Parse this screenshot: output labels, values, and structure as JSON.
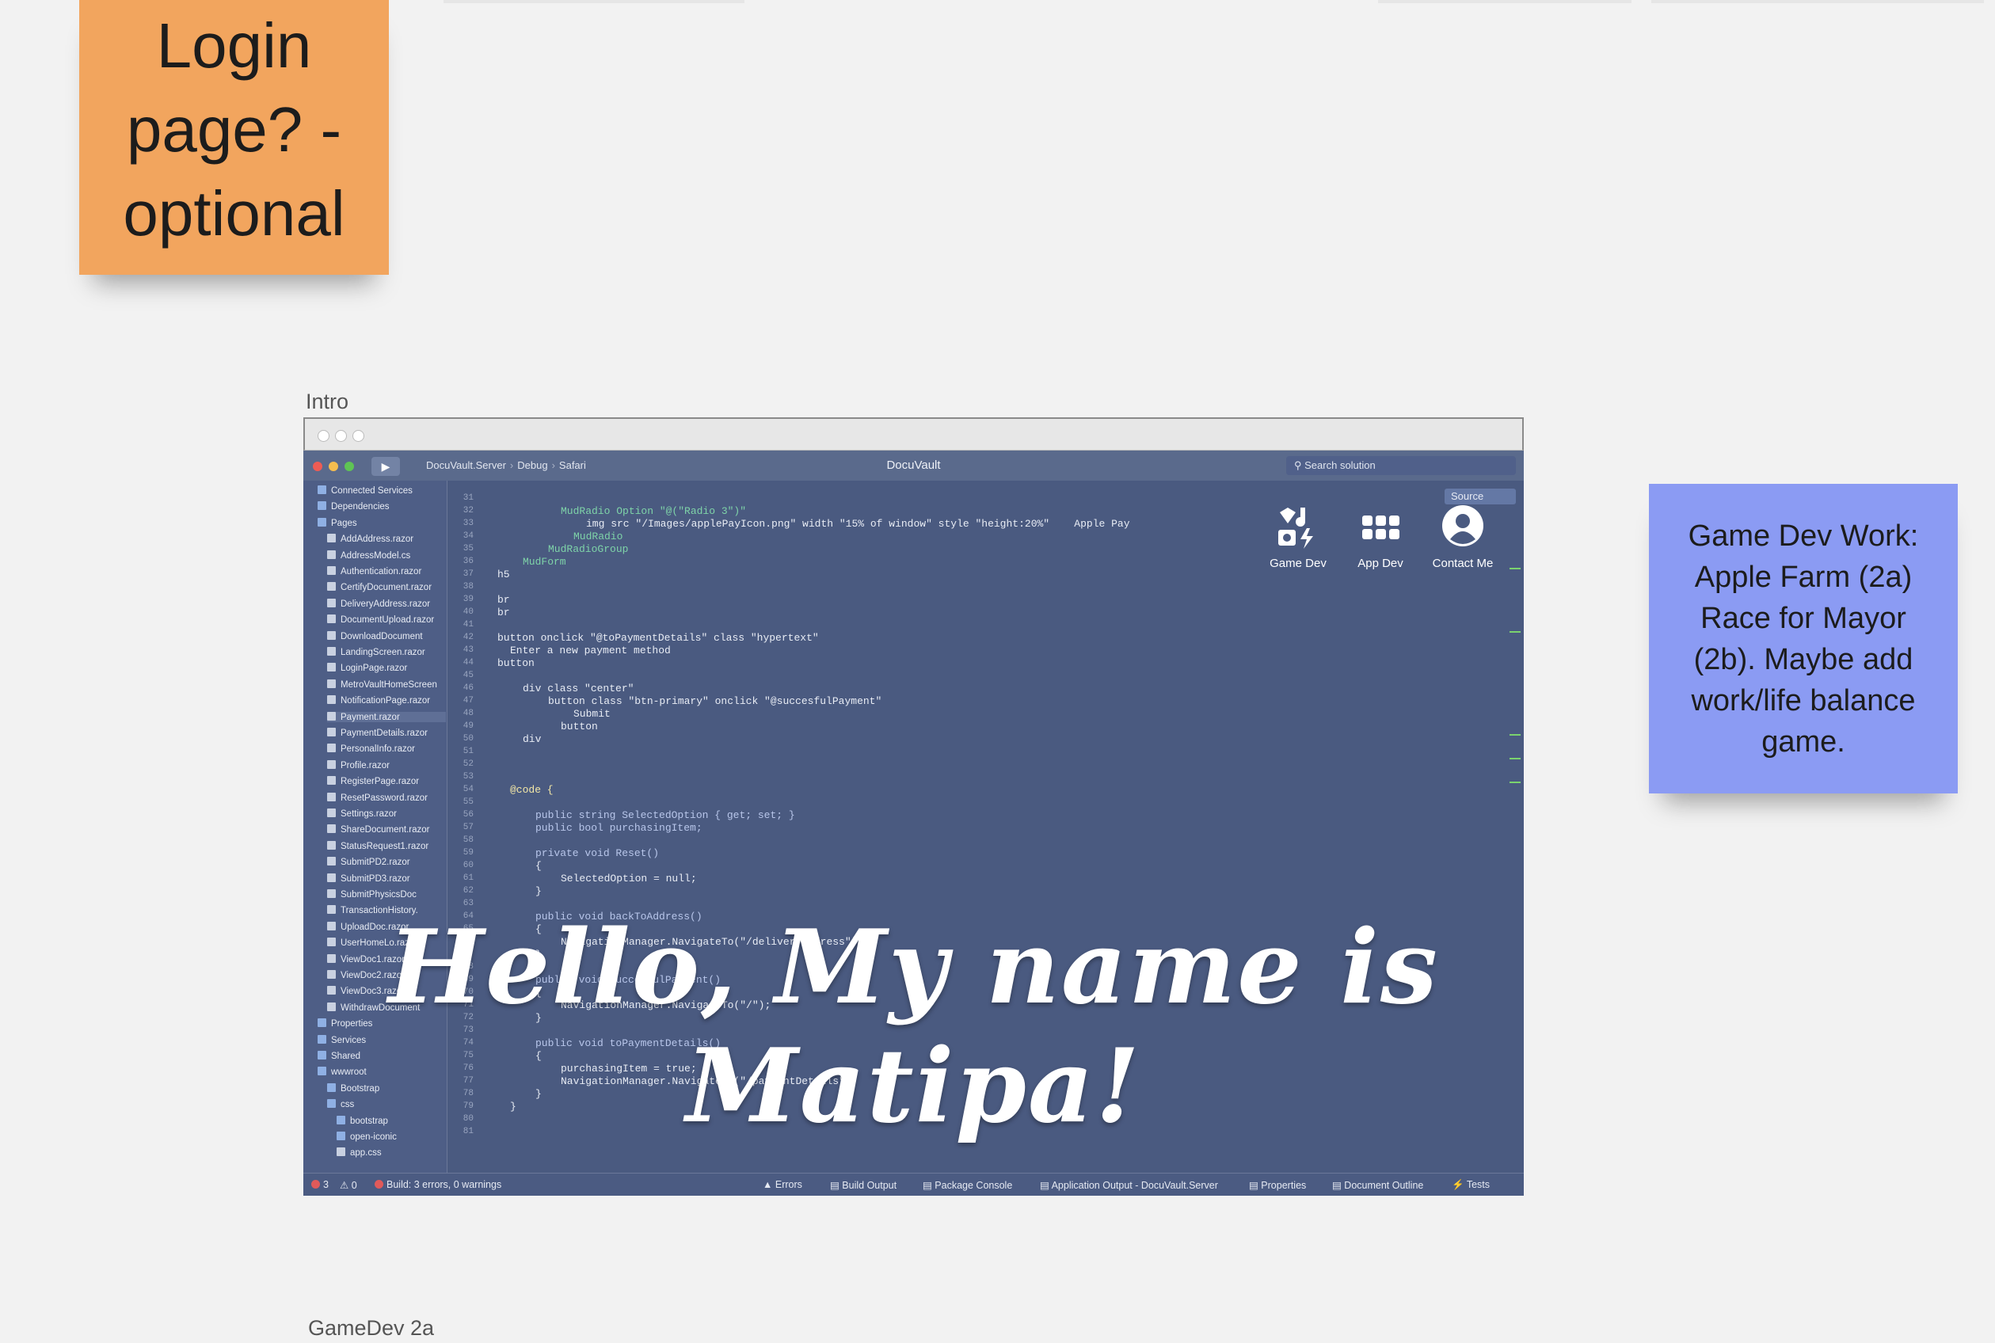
{
  "board": {
    "sticky_orange": "Login page? - optional",
    "sticky_blue": "Game Dev Work: Apple Farm (2a) Race for Mayor (2b). Maybe add work/life balance game.",
    "frame_intro_label": "Intro",
    "frame_gamedev_label": "GameDev 2a"
  },
  "ide": {
    "breadcrumb": [
      "DocuVault.Server",
      "Debug",
      "Safari"
    ],
    "title": "DocuVault",
    "search_placeholder": "Search solution",
    "source_button": "Source",
    "tree": [
      {
        "label": "Connected Services",
        "type": "folder",
        "level": 1
      },
      {
        "label": "Dependencies",
        "type": "folder",
        "level": 1
      },
      {
        "label": "Pages",
        "type": "folder",
        "level": 1
      },
      {
        "label": "AddAddress.razor",
        "type": "file",
        "level": 2
      },
      {
        "label": "AddressModel.cs",
        "type": "file",
        "level": 2
      },
      {
        "label": "Authentication.razor",
        "type": "file",
        "level": 2
      },
      {
        "label": "CertifyDocument.razor",
        "type": "file",
        "level": 2
      },
      {
        "label": "DeliveryAddress.razor",
        "type": "file",
        "level": 2
      },
      {
        "label": "DocumentUpload.razor",
        "type": "file",
        "level": 2
      },
      {
        "label": "DownloadDocument",
        "type": "file",
        "level": 2
      },
      {
        "label": "LandingScreen.razor",
        "type": "file",
        "level": 2
      },
      {
        "label": "LoginPage.razor",
        "type": "file",
        "level": 2
      },
      {
        "label": "MetroVaultHomeScreen",
        "type": "file",
        "level": 2
      },
      {
        "label": "NotificationPage.razor",
        "type": "file",
        "level": 2
      },
      {
        "label": "Payment.razor",
        "type": "file",
        "level": 2,
        "selected": true
      },
      {
        "label": "PaymentDetails.razor",
        "type": "file",
        "level": 2
      },
      {
        "label": "PersonalInfo.razor",
        "type": "file",
        "level": 2
      },
      {
        "label": "Profile.razor",
        "type": "file",
        "level": 2
      },
      {
        "label": "RegisterPage.razor",
        "type": "file",
        "level": 2
      },
      {
        "label": "ResetPassword.razor",
        "type": "file",
        "level": 2
      },
      {
        "label": "Settings.razor",
        "type": "file",
        "level": 2
      },
      {
        "label": "ShareDocument.razor",
        "type": "file",
        "level": 2
      },
      {
        "label": "StatusRequest1.razor",
        "type": "file",
        "level": 2
      },
      {
        "label": "SubmitPD2.razor",
        "type": "file",
        "level": 2
      },
      {
        "label": "SubmitPD3.razor",
        "type": "file",
        "level": 2
      },
      {
        "label": "SubmitPhysicsDoc",
        "type": "file",
        "level": 2
      },
      {
        "label": "TransactionHistory.",
        "type": "file",
        "level": 2
      },
      {
        "label": "UploadDoc.razor",
        "type": "file",
        "level": 2
      },
      {
        "label": "UserHomeLo.razor",
        "type": "file",
        "level": 2
      },
      {
        "label": "ViewDoc1.razor",
        "type": "file",
        "level": 2
      },
      {
        "label": "ViewDoc2.razor",
        "type": "file",
        "level": 2
      },
      {
        "label": "ViewDoc3.razor",
        "type": "file",
        "level": 2
      },
      {
        "label": "WithdrawDocument",
        "type": "file",
        "level": 2
      },
      {
        "label": "Properties",
        "type": "folder",
        "level": 1
      },
      {
        "label": "Services",
        "type": "folder",
        "level": 1
      },
      {
        "label": "Shared",
        "type": "folder",
        "level": 1
      },
      {
        "label": "wwwroot",
        "type": "folder",
        "level": 1
      },
      {
        "label": "Bootstrap",
        "type": "folder",
        "level": 2
      },
      {
        "label": "css",
        "type": "folder",
        "level": 2
      },
      {
        "label": "bootstrap",
        "type": "folder",
        "level": 3
      },
      {
        "label": "open-iconic",
        "type": "folder",
        "level": 3
      },
      {
        "label": "app.css",
        "type": "file",
        "level": 3
      }
    ],
    "line_numbers": [
      "31",
      "32",
      "33",
      "34",
      "35",
      "36",
      "37",
      "38",
      "39",
      "40",
      "41",
      "42",
      "43",
      "44",
      "45",
      "46",
      "47",
      "48",
      "49",
      "50",
      "51",
      "52",
      "53",
      "54",
      "55",
      "56",
      "57",
      "58",
      "59",
      "60",
      "61",
      "62",
      "63",
      "64",
      "65",
      "66",
      "67",
      "68",
      "69",
      "70",
      "71",
      "72",
      "73",
      "74",
      "75",
      "76",
      "77",
      "78",
      "79",
      "80",
      "81"
    ],
    "code": [
      {
        "ln": "32",
        "indent": 6,
        "text": "MudRadio Option \"@(\"Radio 3\")\""
      },
      {
        "ln": "33",
        "indent": 8,
        "text": "img src \"/Images/applePayIcon.png\" width \"15% of window\" style \"height:20%\"    Apple Pay"
      },
      {
        "ln": "34",
        "indent": 7,
        "text": "MudRadio"
      },
      {
        "ln": "35",
        "indent": 5,
        "text": "MudRadioGroup"
      },
      {
        "ln": "36",
        "indent": 3,
        "text": "MudForm"
      },
      {
        "ln": "37",
        "indent": 1,
        "text": "h5"
      },
      {
        "ln": "39",
        "indent": 1,
        "text": "br"
      },
      {
        "ln": "40",
        "indent": 1,
        "text": "br"
      },
      {
        "ln": "42",
        "indent": 1,
        "text": "button onclick \"@toPaymentDetails\" class \"hypertext\""
      },
      {
        "ln": "43",
        "indent": 2,
        "text": "Enter a new payment method"
      },
      {
        "ln": "44",
        "indent": 1,
        "text": "button"
      },
      {
        "ln": "46",
        "indent": 3,
        "text": "div class \"center\""
      },
      {
        "ln": "47",
        "indent": 5,
        "text": "button class \"btn-primary\" onclick \"@succesfulPayment\""
      },
      {
        "ln": "48",
        "indent": 7,
        "text": "Submit"
      },
      {
        "ln": "49",
        "indent": 6,
        "text": "button"
      },
      {
        "ln": "50",
        "indent": 3,
        "text": "div"
      },
      {
        "ln": "54",
        "indent": 2,
        "text": "@code {"
      },
      {
        "ln": "56",
        "indent": 4,
        "text": "public string SelectedOption { get; set; }"
      },
      {
        "ln": "57",
        "indent": 4,
        "text": "public bool purchasingItem;"
      },
      {
        "ln": "59",
        "indent": 4,
        "text": "private void Reset()"
      },
      {
        "ln": "60",
        "indent": 4,
        "text": "{"
      },
      {
        "ln": "61",
        "indent": 6,
        "text": "SelectedOption = null;"
      },
      {
        "ln": "62",
        "indent": 4,
        "text": "}"
      },
      {
        "ln": "64",
        "indent": 4,
        "text": "public void backToAddress()"
      },
      {
        "ln": "65",
        "indent": 4,
        "text": "{"
      },
      {
        "ln": "66",
        "indent": 6,
        "text": "NavigationManager.NavigateTo(\"/deliveryAddress\");"
      },
      {
        "ln": "67",
        "indent": 4,
        "text": "}"
      },
      {
        "ln": "69",
        "indent": 4,
        "text": "public void succesfulPayment()"
      },
      {
        "ln": "70",
        "indent": 4,
        "text": "{"
      },
      {
        "ln": "71",
        "indent": 6,
        "text": "NavigationManager.NavigateTo(\"/\");"
      },
      {
        "ln": "72",
        "indent": 4,
        "text": "}"
      },
      {
        "ln": "74",
        "indent": 4,
        "text": "public void toPaymentDetails()"
      },
      {
        "ln": "75",
        "indent": 4,
        "text": "{"
      },
      {
        "ln": "76",
        "indent": 6,
        "text": "purchasingItem = true;"
      },
      {
        "ln": "77",
        "indent": 6,
        "text": "NavigationManager.NavigateTo(\"/paymentDetails\");"
      },
      {
        "ln": "78",
        "indent": 4,
        "text": "}"
      },
      {
        "ln": "79",
        "indent": 2,
        "text": "}"
      }
    ],
    "status": {
      "errors": "3",
      "warnings": "0",
      "build": "Build: 3 errors, 0 warnings",
      "pads": [
        "Errors",
        "Build Output",
        "Package Console",
        "Application Output - DocuVault.Server",
        "Properties",
        "Document Outline",
        "Tests"
      ]
    }
  },
  "portfolio": {
    "nav": [
      {
        "label": "Game Dev",
        "icon": "game-controller-icon"
      },
      {
        "label": "App Dev",
        "icon": "grid-icon"
      },
      {
        "label": "Contact Me",
        "icon": "person-icon"
      }
    ],
    "headline": "Hello, My name is Matipa!"
  },
  "colors": {
    "sticky_orange": "#f2a55e",
    "sticky_blue": "#8b9bf3",
    "ide_background": "#4a5a80"
  }
}
